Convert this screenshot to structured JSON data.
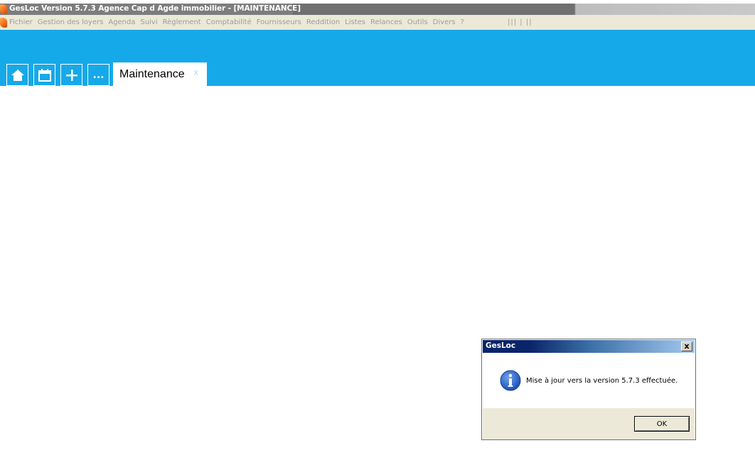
{
  "window": {
    "title": "GesLoc  Version 5.7.3  Agence Cap d Agde immobilier - [MAINTENANCE]"
  },
  "menu": {
    "items": [
      "Fichier",
      "Gestion des loyers",
      "Agenda",
      "Suivi",
      "Règlement",
      "Comptabilité",
      "Fournisseurs",
      "Reddition",
      "Listes",
      "Relances",
      "Outils",
      "Divers",
      "?"
    ],
    "extra": "||| | ||"
  },
  "toolbar": {
    "buttons": [
      {
        "icon": "home-icon"
      },
      {
        "icon": "calendar-icon"
      },
      {
        "icon": "plus-icon"
      },
      {
        "icon": "ellipsis-icon",
        "label": "..."
      }
    ]
  },
  "tabs": [
    {
      "label": "Maintenance",
      "close": "x"
    }
  ],
  "dialog": {
    "title": "GesLoc",
    "close": "x",
    "icon": "info-icon",
    "message": "Mise à jour vers la version 5.7.3 effectuée.",
    "ok_label": "OK"
  },
  "colors": {
    "ribbon": "#16a9e9",
    "menubar": "#ece9d8",
    "dialog_title_start": "#0a246a",
    "dialog_title_end": "#a6caf0"
  }
}
